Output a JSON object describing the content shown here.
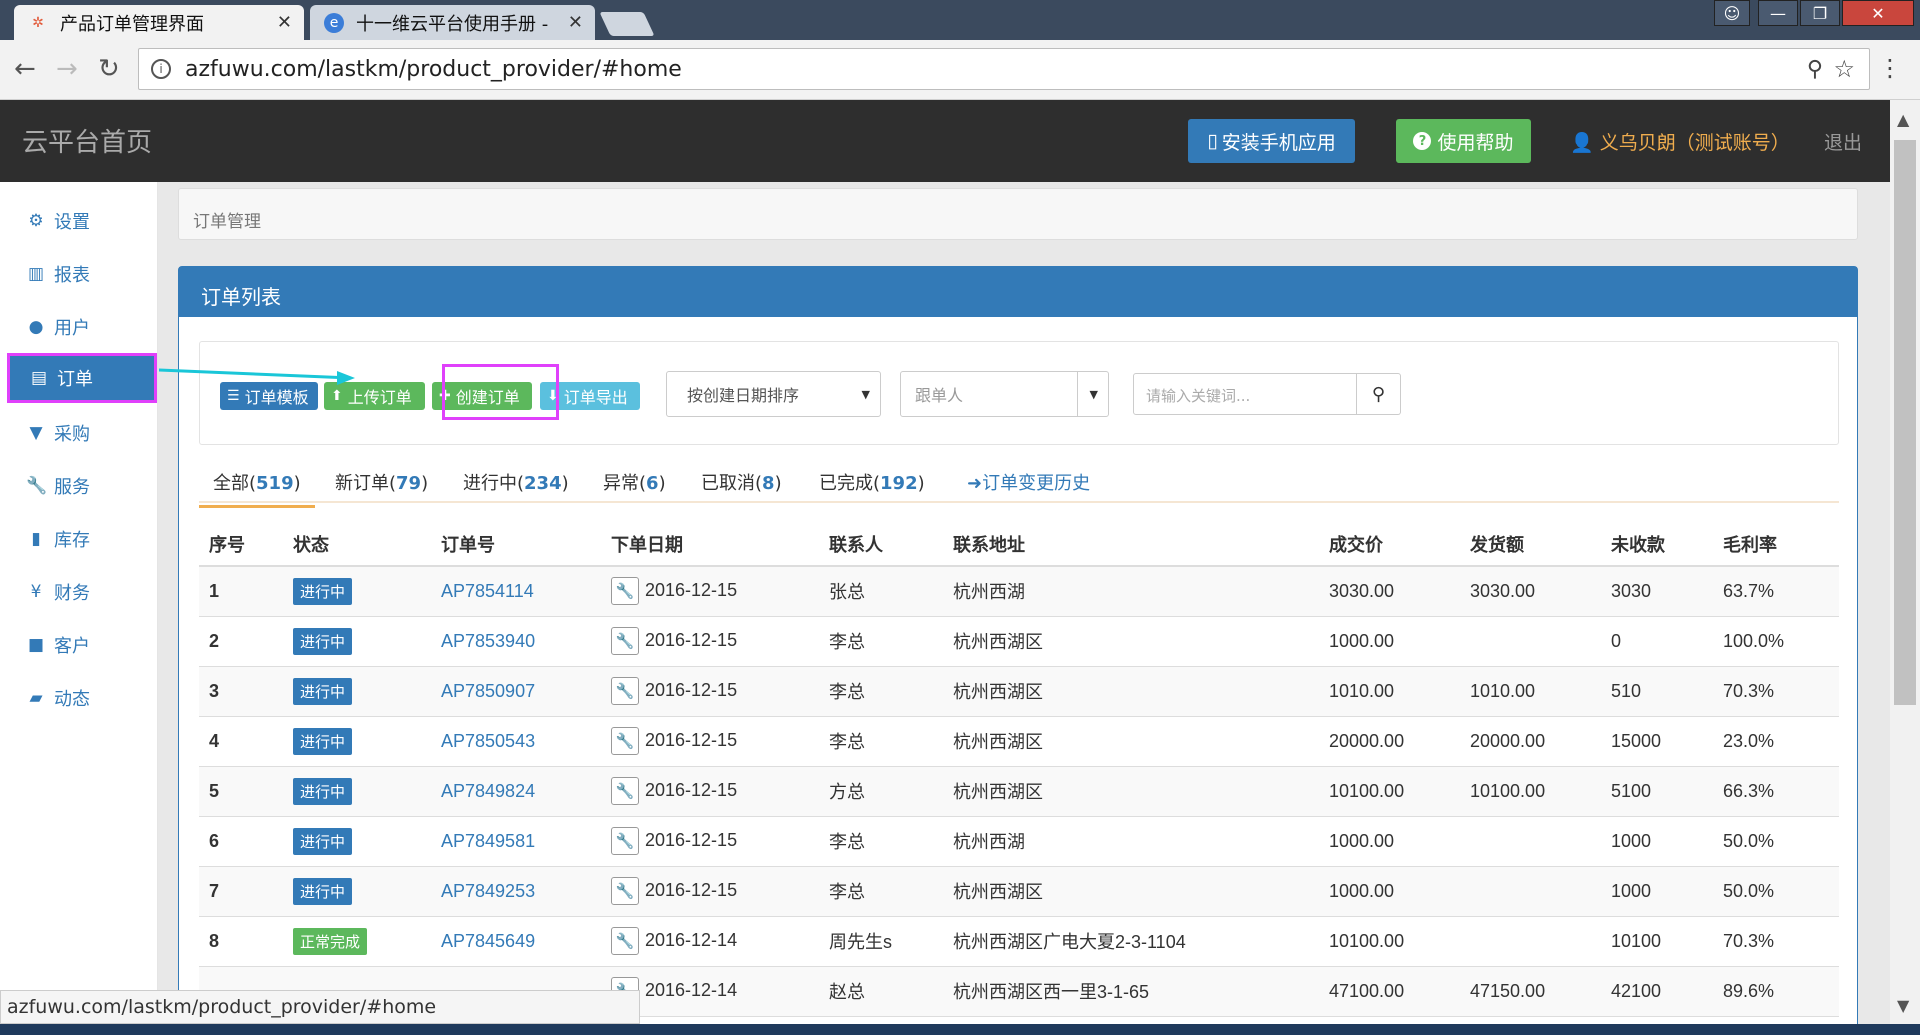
{
  "browser": {
    "tabs": [
      {
        "title": "产品订单管理界面",
        "active": true
      },
      {
        "title": "十一维云平台使用手册 -",
        "active": false
      }
    ],
    "url": "azfuwu.com/lastkm/product_provider/#home",
    "status_url": "azfuwu.com/lastkm/product_provider/#home"
  },
  "header": {
    "title": "云平台首页",
    "install_app": "安装手机应用",
    "help": "使用帮助",
    "user": "义乌贝朗（测试账号）",
    "logout": "退出"
  },
  "sidebar": {
    "items": [
      {
        "label": "设置",
        "icon": "gear-icon"
      },
      {
        "label": "报表",
        "icon": "bar-chart-icon"
      },
      {
        "label": "用户",
        "icon": "user-icon"
      },
      {
        "label": "订单",
        "icon": "list-icon"
      },
      {
        "label": "采购",
        "icon": "cart-icon"
      },
      {
        "label": "服务",
        "icon": "wrench-icon"
      },
      {
        "label": "库存",
        "icon": "barcode-icon"
      },
      {
        "label": "财务",
        "icon": "yen-icon"
      },
      {
        "label": "客户",
        "icon": "briefcase-icon"
      },
      {
        "label": "动态",
        "icon": "comment-icon"
      }
    ],
    "active_index": 3
  },
  "breadcrumb": "订单管理",
  "panel": {
    "title": "订单列表",
    "buttons": {
      "template": "订单模板",
      "upload": "上传订单",
      "create": "创建订单",
      "export": "订单导出"
    },
    "sort_select": "按创建日期排序",
    "follow_placeholder": "跟单人",
    "search_placeholder": "请输入关键词..."
  },
  "order_tabs": [
    {
      "label": "全部",
      "count": "519"
    },
    {
      "label": "新订单",
      "count": "79"
    },
    {
      "label": "进行中",
      "count": "234"
    },
    {
      "label": "异常",
      "count": "6"
    },
    {
      "label": "已取消",
      "count": "8"
    },
    {
      "label": "已完成",
      "count": "192"
    }
  ],
  "history_label": "订单变更历史",
  "table": {
    "headers": [
      "序号",
      "状态",
      "订单号",
      "下单日期",
      "联系人",
      "联系地址",
      "成交价",
      "发货额",
      "未收款",
      "毛利率"
    ],
    "rows": [
      {
        "no": "1",
        "status": "进行中",
        "order": "AP7854114",
        "date": "2016-12-15",
        "contact": "张总",
        "address": "杭州西湖",
        "price": "3030.00",
        "shipped": "3030.00",
        "unpaid": "3030",
        "margin": "63.7%"
      },
      {
        "no": "2",
        "status": "进行中",
        "order": "AP7853940",
        "date": "2016-12-15",
        "contact": "李总",
        "address": "杭州西湖区",
        "price": "1000.00",
        "shipped": "",
        "unpaid": "0",
        "margin": "100.0%"
      },
      {
        "no": "3",
        "status": "进行中",
        "order": "AP7850907",
        "date": "2016-12-15",
        "contact": "李总",
        "address": "杭州西湖区",
        "price": "1010.00",
        "shipped": "1010.00",
        "unpaid": "510",
        "margin": "70.3%"
      },
      {
        "no": "4",
        "status": "进行中",
        "order": "AP7850543",
        "date": "2016-12-15",
        "contact": "李总",
        "address": "杭州西湖区",
        "price": "20000.00",
        "shipped": "20000.00",
        "unpaid": "15000",
        "margin": "23.0%"
      },
      {
        "no": "5",
        "status": "进行中",
        "order": "AP7849824",
        "date": "2016-12-15",
        "contact": "方总",
        "address": "杭州西湖区",
        "price": "10100.00",
        "shipped": "10100.00",
        "unpaid": "5100",
        "margin": "66.3%"
      },
      {
        "no": "6",
        "status": "进行中",
        "order": "AP7849581",
        "date": "2016-12-15",
        "contact": "李总",
        "address": "杭州西湖",
        "price": "1000.00",
        "shipped": "",
        "unpaid": "1000",
        "margin": "50.0%"
      },
      {
        "no": "7",
        "status": "进行中",
        "order": "AP7849253",
        "date": "2016-12-15",
        "contact": "李总",
        "address": "杭州西湖区",
        "price": "1000.00",
        "shipped": "",
        "unpaid": "1000",
        "margin": "50.0%"
      },
      {
        "no": "8",
        "status": "正常完成",
        "order": "AP7845649",
        "date": "2016-12-14",
        "contact": "周先生s",
        "address": "杭州西湖区广电大夏2-3-1104",
        "price": "10100.00",
        "shipped": "",
        "unpaid": "10100",
        "margin": "70.3%"
      },
      {
        "no": "",
        "status": "",
        "order": "",
        "date": "2016-12-14",
        "contact": "赵总",
        "address": "杭州西湖区西一里3-1-65",
        "price": "47100.00",
        "shipped": "47150.00",
        "unpaid": "42100",
        "margin": "89.6%"
      }
    ]
  },
  "colors": {
    "primary": "#337ab7",
    "success": "#5cb85c",
    "info": "#5bc0de",
    "warning": "#f0ad4e",
    "highlight": "#e040fb",
    "header_bg": "#2e2e2e"
  }
}
